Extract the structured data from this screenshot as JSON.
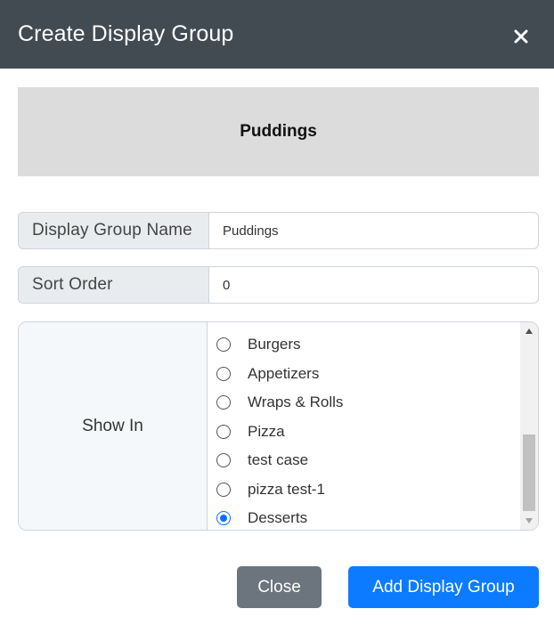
{
  "modal": {
    "title": "Create Display Group",
    "close_icon": "close-icon"
  },
  "preview": {
    "text": "Puddings"
  },
  "form": {
    "name_label": "Display Group Name",
    "name_value": "Puddings",
    "sort_label": "Sort Order",
    "sort_value": "0",
    "show_in_label": "Show In",
    "show_in_options": [
      {
        "label": "Burgers",
        "checked": false
      },
      {
        "label": "Appetizers",
        "checked": false
      },
      {
        "label": "Wraps & Rolls",
        "checked": false
      },
      {
        "label": "Pizza",
        "checked": false
      },
      {
        "label": "test case",
        "checked": false
      },
      {
        "label": "pizza test-1",
        "checked": false
      },
      {
        "label": "Desserts",
        "checked": true
      }
    ]
  },
  "footer": {
    "close_label": "Close",
    "add_label": "Add Display Group"
  },
  "colors": {
    "header_bg": "#424b52",
    "primary": "#0d7bff",
    "secondary": "#6c757d"
  }
}
